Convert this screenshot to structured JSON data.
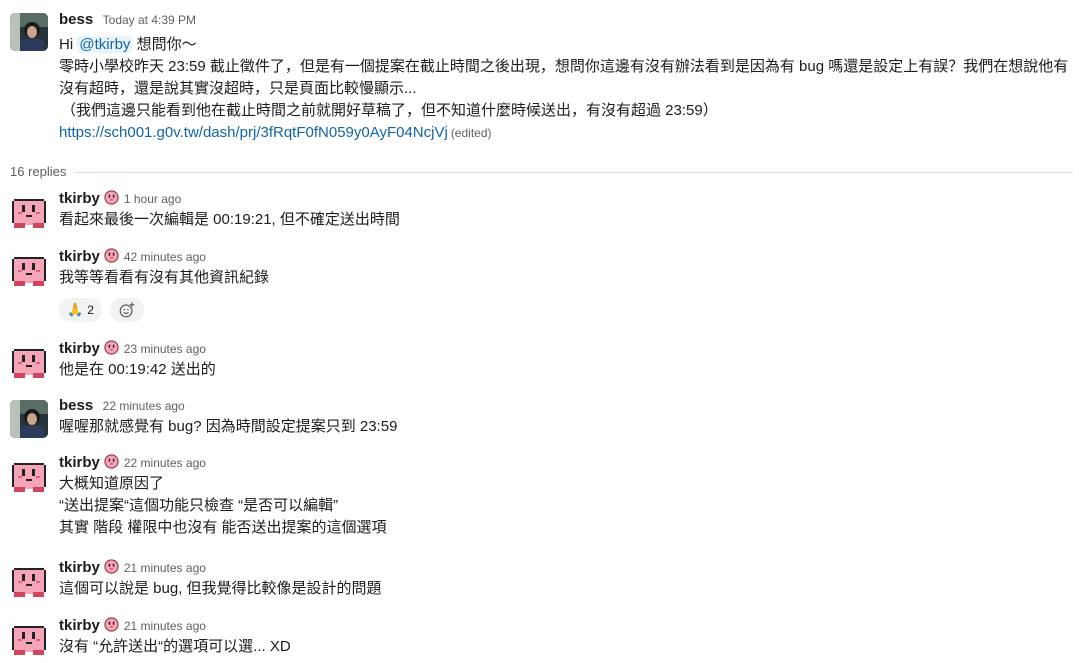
{
  "thread": {
    "root": {
      "author": "bess",
      "time": "Today at 4:39 PM",
      "greeting": "Hi",
      "mention": "@tkirby",
      "greeting_rest": "想問你～",
      "lines": [
        "零時小學校昨天 23:59 截止徵件了，但是有一個提案在截止時間之後出現，想問你這邊有沒有辦法看到是因為有 bug 嗎還是設定上有誤？我們在想說他有沒有超時，還是說其實沒超時，只是頁面比較慢顯示...",
        "（我們這邊只能看到他在截止時間之前就開好草稿了，但不知道什麼時候送出，有沒有超過 23:59）"
      ],
      "link": "https://sch001.g0v.tw/dash/prj/3fRqtF0fN059y0AyF04NcjVj",
      "edited": "(edited)"
    },
    "replies_label": "16 replies",
    "replies": [
      {
        "author": "tkirby",
        "time": "1 hour ago",
        "lines": [
          "看起來最後一次編輯是 00:19:21, 但不確定送出時間"
        ]
      },
      {
        "author": "tkirby",
        "time": "42 minutes ago",
        "lines": [
          "我等等看看有沒有其他資訊紀錄"
        ],
        "reactions": [
          {
            "emoji": "🙏",
            "count": "2"
          }
        ]
      },
      {
        "author": "tkirby",
        "time": "23 minutes ago",
        "lines": [
          "他是在 00:19:42 送出的"
        ]
      },
      {
        "author": "bess",
        "time": "22 minutes ago",
        "lines": [
          "喔喔那就感覺有 bug? 因為時間設定提案只到 23:59"
        ]
      },
      {
        "author": "tkirby",
        "time": "22 minutes ago",
        "lines": [
          "大概知道原因了",
          "“送出提案“這個功能只檢查 “是否可以編輯”",
          "其實 階段 權限中也沒有 能否送出提案的這個選項"
        ]
      },
      {
        "author": "tkirby",
        "time": "21 minutes ago",
        "lines": [
          "這個可以說是 bug, 但我覺得比較像是設計的問題"
        ]
      },
      {
        "author": "tkirby",
        "time": "21 minutes ago",
        "lines": [
          "沒有 “允許送出“的選項可以選... XD"
        ]
      }
    ]
  },
  "icons": {
    "avatar_bess": "person-photo-avatar",
    "avatar_tkirby": "kirby-pixel-avatar",
    "status": "kirby-status-emoji",
    "add_reaction": "add-reaction-icon"
  },
  "colors": {
    "link": "#1264a3",
    "mention_bg": "#e8f5fa",
    "kirby_pink": "#f4a6b8"
  }
}
